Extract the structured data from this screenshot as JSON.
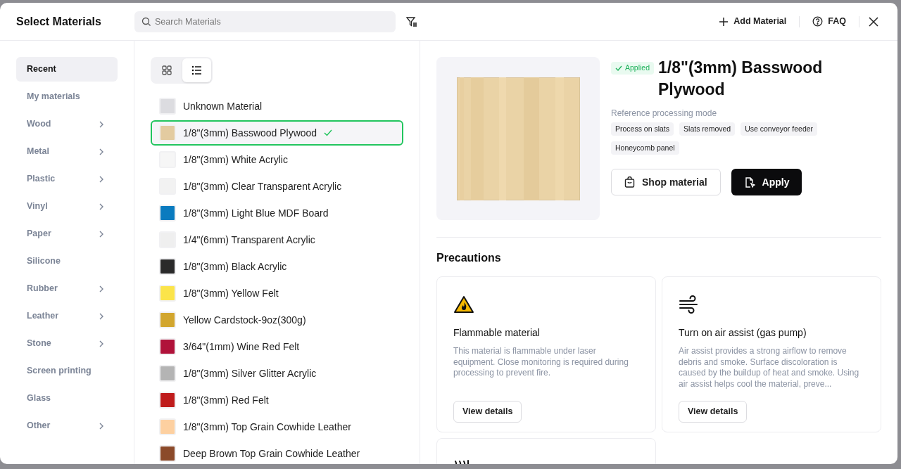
{
  "dialog": {
    "title": "Select Materials",
    "search": {
      "placeholder": "Search Materials"
    },
    "actions": [
      "Add Material",
      "FAQ"
    ]
  },
  "sidebar": {
    "items": [
      {
        "label": "Recent",
        "selected": true,
        "has_children": false
      },
      {
        "label": "My materials",
        "selected": false,
        "has_children": false
      },
      {
        "label": "Wood",
        "selected": false,
        "has_children": true
      },
      {
        "label": "Metal",
        "selected": false,
        "has_children": true
      },
      {
        "label": "Plastic",
        "selected": false,
        "has_children": true
      },
      {
        "label": "Vinyl",
        "selected": false,
        "has_children": true
      },
      {
        "label": "Paper",
        "selected": false,
        "has_children": true
      },
      {
        "label": "Silicone",
        "selected": false,
        "has_children": false
      },
      {
        "label": "Rubber",
        "selected": false,
        "has_children": true
      },
      {
        "label": "Leather",
        "selected": false,
        "has_children": true
      },
      {
        "label": "Stone",
        "selected": false,
        "has_children": true
      },
      {
        "label": "Screen printing",
        "selected": false,
        "has_children": false
      },
      {
        "label": "Glass",
        "selected": false,
        "has_children": false
      },
      {
        "label": "Other",
        "selected": false,
        "has_children": true
      }
    ]
  },
  "view_toggle": [
    {
      "kind": "grid",
      "selected": false
    },
    {
      "kind": "list",
      "selected": true
    }
  ],
  "materials": [
    {
      "name": "Unknown Material",
      "color": "#dcdce0",
      "selected": false
    },
    {
      "name": "1/8\"(3mm) Basswood Plywood",
      "color": "#e3cba0",
      "selected": true
    },
    {
      "name": "1/8\"(3mm) White Acrylic",
      "color": "#f6f6f6",
      "selected": false
    },
    {
      "name": "1/8\"(3mm) Clear Transparent Acrylic",
      "color": "#f2f2f2",
      "selected": false
    },
    {
      "name": "1/8\"(3mm) Light Blue MDF Board",
      "color": "#0a7bbf",
      "selected": false
    },
    {
      "name": "1/4\"(6mm) Transparent Acrylic",
      "color": "#efefef",
      "selected": false
    },
    {
      "name": "1/8\"(3mm) Black Acrylic",
      "color": "#2a2a2a",
      "selected": false
    },
    {
      "name": "1/8\"(3mm) Yellow Felt",
      "color": "#fbe44a",
      "selected": false
    },
    {
      "name": "Yellow Cardstock-9oz(300g)",
      "color": "#d2a62e",
      "selected": false
    },
    {
      "name": "3/64\"(1mm) Wine Red Felt",
      "color": "#b0123a",
      "selected": false
    },
    {
      "name": "1/8\"(3mm) Silver Glitter Acrylic",
      "color": "#b4b4b4",
      "selected": false
    },
    {
      "name": "1/8\"(3mm) Red Felt",
      "color": "#bf1c1c",
      "selected": false
    },
    {
      "name": "1/8\"(3mm) Top Grain Cowhide Leather",
      "color": "#fdd0a0",
      "selected": false
    },
    {
      "name": "Deep Brown Top Grain Cowhide Leather",
      "color": "#8b4a2a",
      "selected": false
    }
  ],
  "detail": {
    "status": "Applied",
    "title": "1/8\"(3mm) Basswood Plywood",
    "mode_label": "Reference processing mode",
    "modes": [
      "Process on slats",
      "Slats removed",
      "Use conveyor feeder",
      "Honeycomb panel"
    ],
    "buttons": [
      {
        "kind": "secondary",
        "label": "Shop material"
      },
      {
        "kind": "primary",
        "label": "Apply"
      }
    ],
    "precautions_title": "Precautions",
    "precautions": [
      {
        "kind": "flame",
        "title": "Flammable material",
        "text": "This material is flammable under laser equipment. Close monitoring is required during processing to prevent fire.",
        "button": "View details"
      },
      {
        "kind": "wind",
        "title": "Turn on air assist (gas pump)",
        "text": "Air assist provides a strong airflow to remove debris and smoke. Surface discoloration is caused by the buildup of heat and smoke. Using air assist helps cool the material, preve...",
        "button": "View details"
      },
      {
        "kind": "heat"
      }
    ]
  }
}
